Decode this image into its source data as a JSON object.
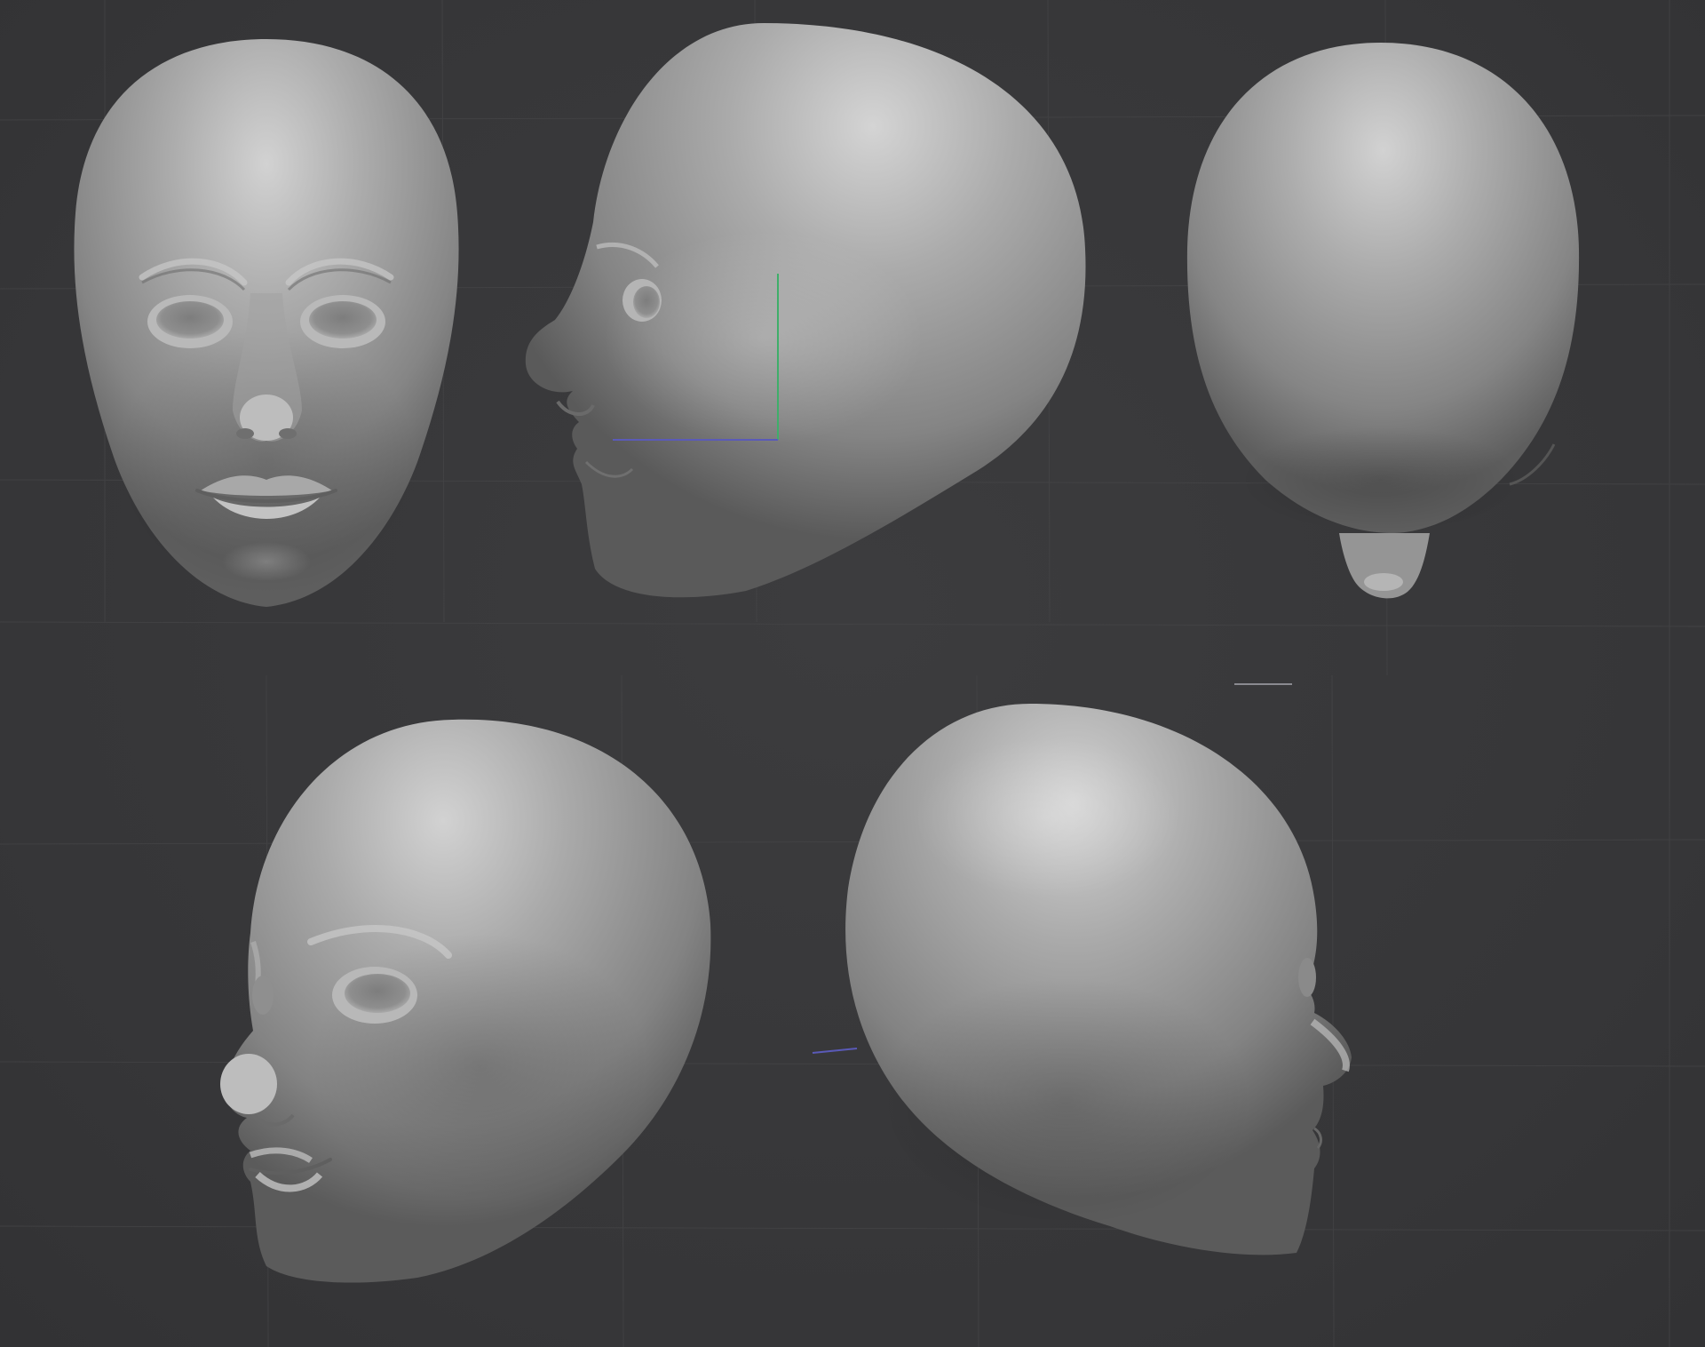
{
  "viewport": {
    "background_color": "#38383a",
    "grid_color": "#464648",
    "clay_color": "#9a9a9a",
    "gizmo_green": "#3fae6a",
    "gizmo_blue": "#5a5ab8"
  },
  "views": [
    {
      "name": "front-view",
      "orientation": "front"
    },
    {
      "name": "left-profile-view",
      "orientation": "left-profile"
    },
    {
      "name": "back-view",
      "orientation": "back"
    },
    {
      "name": "three-quarter-left-view",
      "orientation": "three-quarter-left"
    },
    {
      "name": "back-three-quarter-right-view",
      "orientation": "back-three-quarter-right"
    }
  ]
}
